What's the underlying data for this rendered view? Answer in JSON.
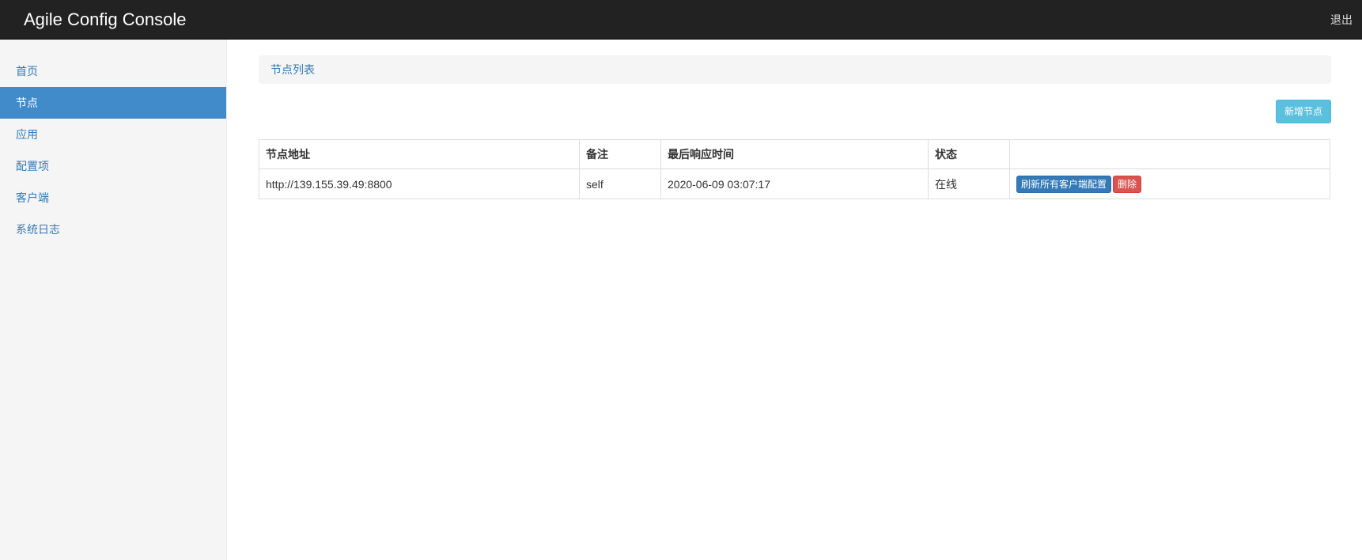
{
  "header": {
    "brand": "Agile Config Console",
    "logout_label": "退出"
  },
  "sidebar": {
    "items": [
      {
        "label": "首页",
        "active": false
      },
      {
        "label": "节点",
        "active": true
      },
      {
        "label": "应用",
        "active": false
      },
      {
        "label": "配置项",
        "active": false
      },
      {
        "label": "客户端",
        "active": false
      },
      {
        "label": "系统日志",
        "active": false
      }
    ]
  },
  "breadcrumb": {
    "label": "节点列表"
  },
  "toolbar": {
    "add_node_label": "新增节点"
  },
  "table": {
    "headers": [
      "节点地址",
      "备注",
      "最后响应时间",
      "状态",
      ""
    ],
    "rows": [
      {
        "address": "http://139.155.39.49:8800",
        "note": "self",
        "last_response": "2020-06-09 03:07:17",
        "status": "在线",
        "actions": {
          "refresh_label": "刷新所有客户端配置",
          "delete_label": "删除"
        }
      }
    ]
  },
  "colors": {
    "navbar_bg": "#222222",
    "accent": "#428bca",
    "link": "#337ab7",
    "info": "#5bc0de",
    "danger": "#d9534f",
    "success_text": "#3c763d"
  }
}
